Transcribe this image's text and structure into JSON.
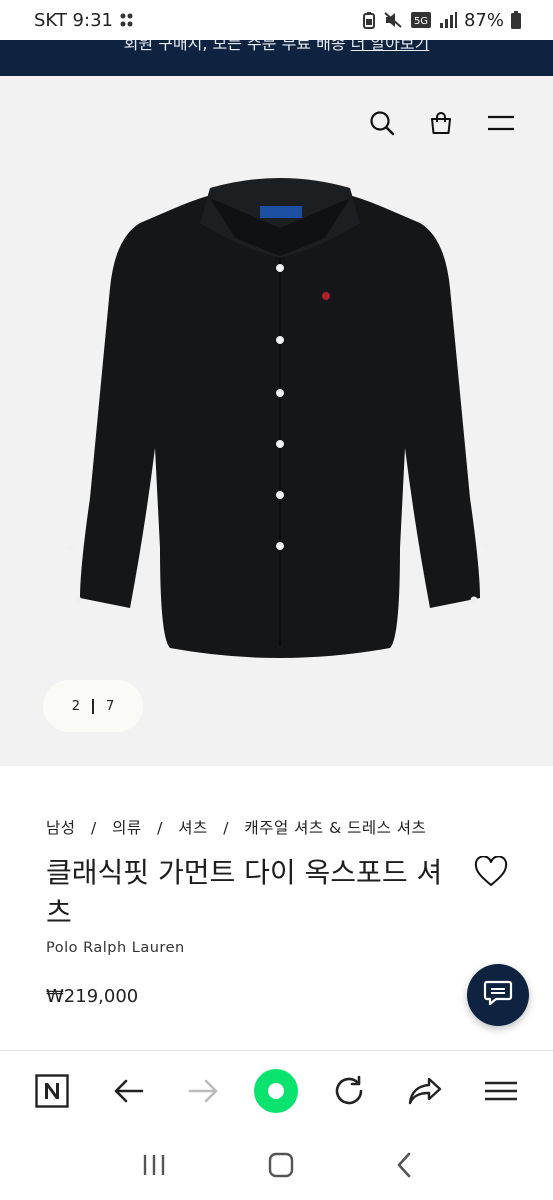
{
  "status_bar": {
    "carrier_time": "SKT 9:31",
    "network": "5G",
    "battery": "87%"
  },
  "banner": {
    "text": "회원 구매시, 모든 주문 무료 배송",
    "link": "더 알아보기"
  },
  "gallery": {
    "current": "2",
    "total": "7"
  },
  "breadcrumb": [
    "남성",
    "/",
    "의류",
    "/",
    "셔츠",
    "/",
    "캐주얼 셔츠 & 드레스 셔츠"
  ],
  "product": {
    "title": "클래식핏 가먼트 다이 옥스포드 셔츠",
    "brand": "Polo Ralph Lauren",
    "price": "₩219,000"
  },
  "icons": {
    "header": [
      "search-icon",
      "shopping-bag-icon",
      "menu-icon"
    ],
    "browser": [
      "naver-n-icon",
      "back-arrow-icon",
      "forward-arrow-icon",
      "green-home-icon",
      "refresh-icon",
      "share-icon",
      "hamburger-icon"
    ],
    "system": [
      "recent-apps-icon",
      "home-icon",
      "back-icon"
    ]
  },
  "colors": {
    "brand_navy": "#0e2340",
    "green_button": "#0ae36d",
    "hero_bg": "#f2f2f2",
    "shirt": "#141618"
  }
}
